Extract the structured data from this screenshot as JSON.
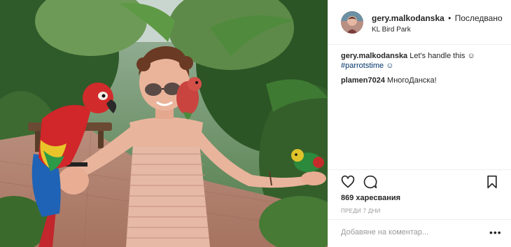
{
  "post": {
    "photo_alt": "",
    "header": {
      "username": "gery.malkodanska",
      "separator": "•",
      "follow_status": "Последвано",
      "location": "KL Bird Park"
    },
    "caption": {
      "username": "gery.malkodanska",
      "text": "Let's handle this ☺",
      "hashtag": "#parrotstime ☺"
    },
    "comments": [
      {
        "username": "plamen7024",
        "text": "МногоДанска!"
      }
    ],
    "likes_label": "869 харесвания",
    "time_label": "ПРЕДИ 7 ДНИ",
    "add_comment_placeholder": "Добавяне на коментар...",
    "more_label": "•••"
  },
  "icons": {
    "like": "heart-icon",
    "comment": "comment-bubble-icon",
    "save": "bookmark-icon",
    "more": "more-dots-icon"
  },
  "colors": {
    "hashtag": "#003569",
    "divider": "#efefef",
    "muted": "#999999"
  }
}
